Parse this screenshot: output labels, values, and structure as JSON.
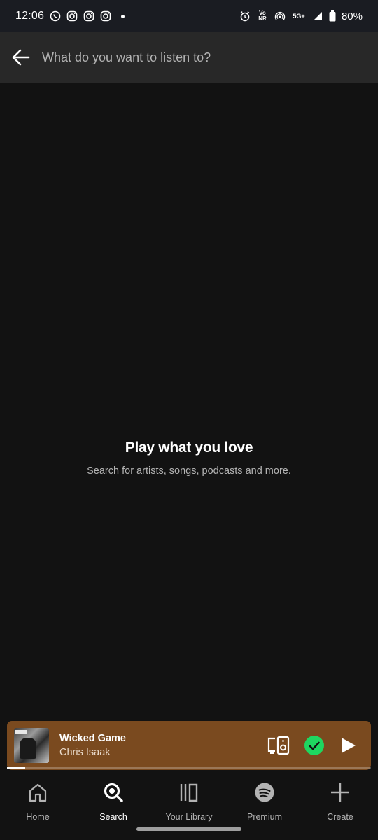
{
  "status_bar": {
    "time": "12:06",
    "battery": "80%",
    "network": "5G+",
    "volte_label": "Vo NR",
    "notification_icons": [
      "whatsapp-icon",
      "instagram-icon",
      "instagram-icon",
      "instagram-icon"
    ]
  },
  "search": {
    "placeholder": "What do you want to listen to?"
  },
  "empty_state": {
    "title": "Play what you love",
    "subtitle": "Search for artists, songs, podcasts and more."
  },
  "now_playing": {
    "title": "Wicked Game",
    "artist": "Chris Isaak",
    "background_color": "#7a4a1f",
    "progress": 0.05,
    "liked": true
  },
  "nav": {
    "items": [
      {
        "label": "Home",
        "icon": "home-icon",
        "active": false
      },
      {
        "label": "Search",
        "icon": "search-icon",
        "active": true
      },
      {
        "label": "Your Library",
        "icon": "library-icon",
        "active": false
      },
      {
        "label": "Premium",
        "icon": "spotify-icon",
        "active": false
      },
      {
        "label": "Create",
        "icon": "plus-icon",
        "active": false
      }
    ]
  },
  "colors": {
    "background": "#121212",
    "search_bar": "#282828",
    "accent_green": "#1ed760",
    "secondary_text": "#b3b3b3"
  }
}
